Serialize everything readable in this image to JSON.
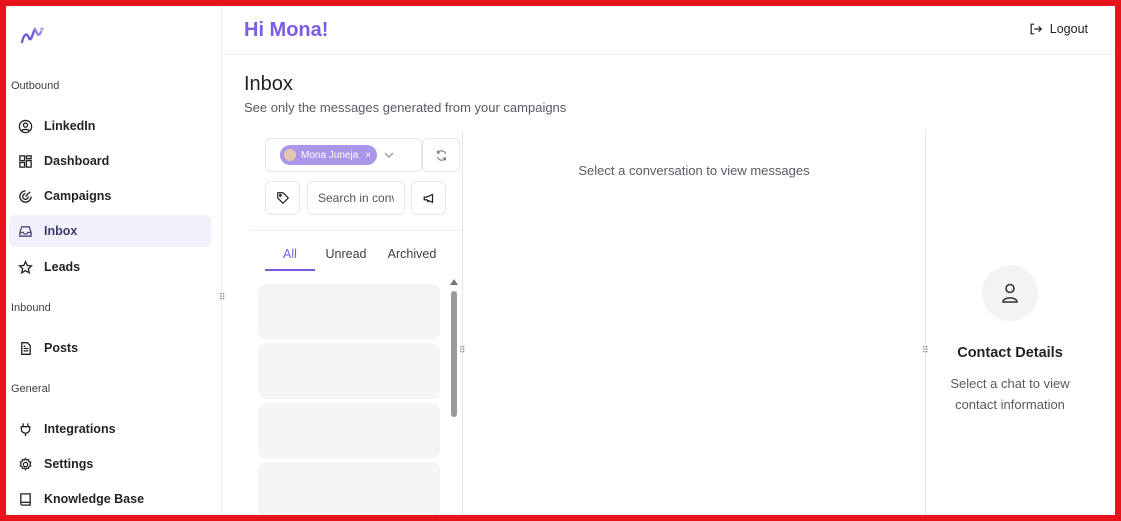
{
  "sidebar": {
    "sections": {
      "outbound": "Outbound",
      "inbound": "Inbound",
      "general": "General"
    },
    "items": [
      {
        "label": "LinkedIn",
        "icon": "user-circle-icon"
      },
      {
        "label": "Dashboard",
        "icon": "dashboard-grid-icon"
      },
      {
        "label": "Campaigns",
        "icon": "campaigns-icon"
      },
      {
        "label": "Inbox",
        "icon": "inbox-icon",
        "active": true
      },
      {
        "label": "Leads",
        "icon": "star-icon"
      },
      {
        "label": "Posts",
        "icon": "document-icon"
      },
      {
        "label": "Integrations",
        "icon": "plug-icon"
      },
      {
        "label": "Settings",
        "icon": "gear-icon"
      },
      {
        "label": "Knowledge Base",
        "icon": "book-icon"
      }
    ]
  },
  "header": {
    "greeting": "Hi Mona!",
    "logout_label": "Logout"
  },
  "page": {
    "title": "Inbox",
    "subtitle": "See only the messages generated from your campaigns"
  },
  "conversations": {
    "account_chip": "Mona Juneja",
    "search_placeholder": "Search in conversations",
    "tabs": [
      "All",
      "Unread",
      "Archived"
    ],
    "active_tab": "All"
  },
  "messages": {
    "empty_text": "Select a conversation to view messages"
  },
  "contact": {
    "title": "Contact Details",
    "empty_text": "Select a chat to view contact information"
  },
  "colors": {
    "accent": "#7b5ce6",
    "chip": "#a996e8",
    "frame": "#e8141b"
  }
}
